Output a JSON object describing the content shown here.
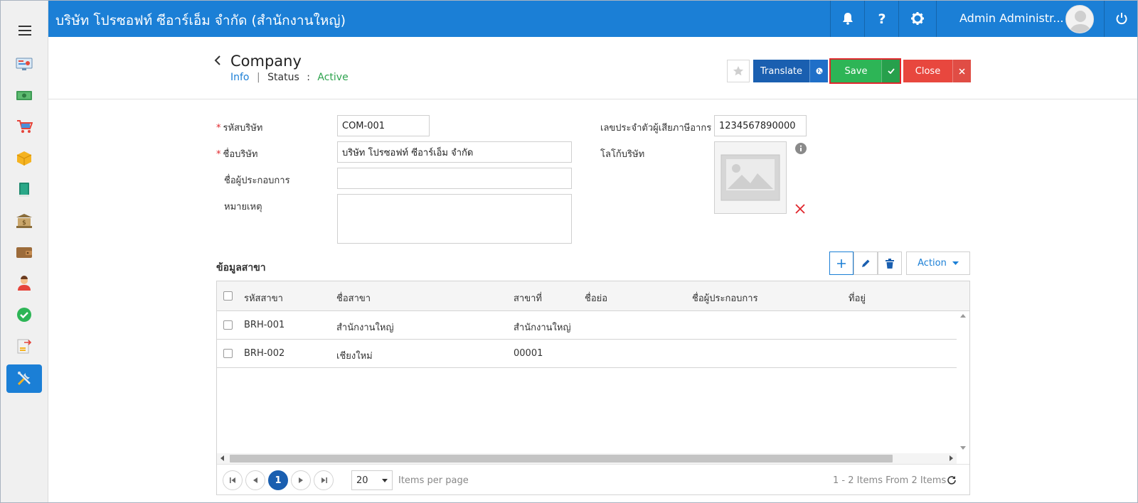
{
  "header": {
    "company_name": "บริษัท โปรซอฟท์ ซีอาร์เอ็ม จำกัด (สำนักงานใหญ่)",
    "user_name": "Admin Administr..."
  },
  "sidebar": {
    "items": [
      {
        "icon": "dashboard-icon"
      },
      {
        "icon": "money-icon"
      },
      {
        "icon": "shopping-cart-icon"
      },
      {
        "icon": "inventory-box-icon"
      },
      {
        "icon": "book-icon"
      },
      {
        "icon": "bank-icon"
      },
      {
        "icon": "wallet-icon"
      },
      {
        "icon": "employee-icon"
      },
      {
        "icon": "approval-check-icon"
      },
      {
        "icon": "transfer-document-icon"
      },
      {
        "icon": "tools-icon",
        "active": true
      }
    ]
  },
  "page": {
    "title": "Company",
    "breadcrumb_info": "Info",
    "breadcrumb_separator": "|",
    "status_label": "Status",
    "status_colon": ":",
    "status_value": "Active"
  },
  "toolbar": {
    "translate_label": "Translate",
    "save_label": "Save",
    "close_label": "Close"
  },
  "form": {
    "company_code_label": "รหัสบริษัท",
    "company_code_value": "COM-001",
    "company_name_label": "ชื่อบริษัท",
    "company_name_value": "บริษัท โปรซอฟท์ ซีอาร์เอ็ม จำกัด",
    "operator_name_label": "ชื่อผู้ประกอบการ",
    "operator_name_value": "",
    "remark_label": "หมายเหตุ",
    "remark_value": "",
    "tax_id_label": "เลขประจำตัวผู้เสียภาษีอากร",
    "tax_id_value": "1234567890000",
    "logo_label": "โลโก้บริษัท"
  },
  "branches": {
    "section_title": "ข้อมูลสาขา",
    "action_label": "Action",
    "columns": [
      "รหัสสาขา",
      "ชื่อสาขา",
      "สาขาที่",
      "ชื่อย่อ",
      "ชื่อผู้ประกอบการ",
      "ที่อยู่"
    ],
    "rows": [
      [
        "BRH-001",
        "สำนักงานใหญ่",
        "สำนักงานใหญ่",
        "",
        "",
        ""
      ],
      [
        "BRH-002",
        "เชียงใหม่",
        "00001",
        "",
        "",
        ""
      ]
    ],
    "pager": {
      "current_page": "1",
      "page_size": "20",
      "items_per_page_label": "Items per page",
      "summary": "1 - 2 Items From 2 Items"
    }
  },
  "colors": {
    "primary": "#1b7fd6",
    "translate": "#1a5fb0",
    "save": "#2db556",
    "close": "#e8473e",
    "active_status": "#2ea34e"
  }
}
